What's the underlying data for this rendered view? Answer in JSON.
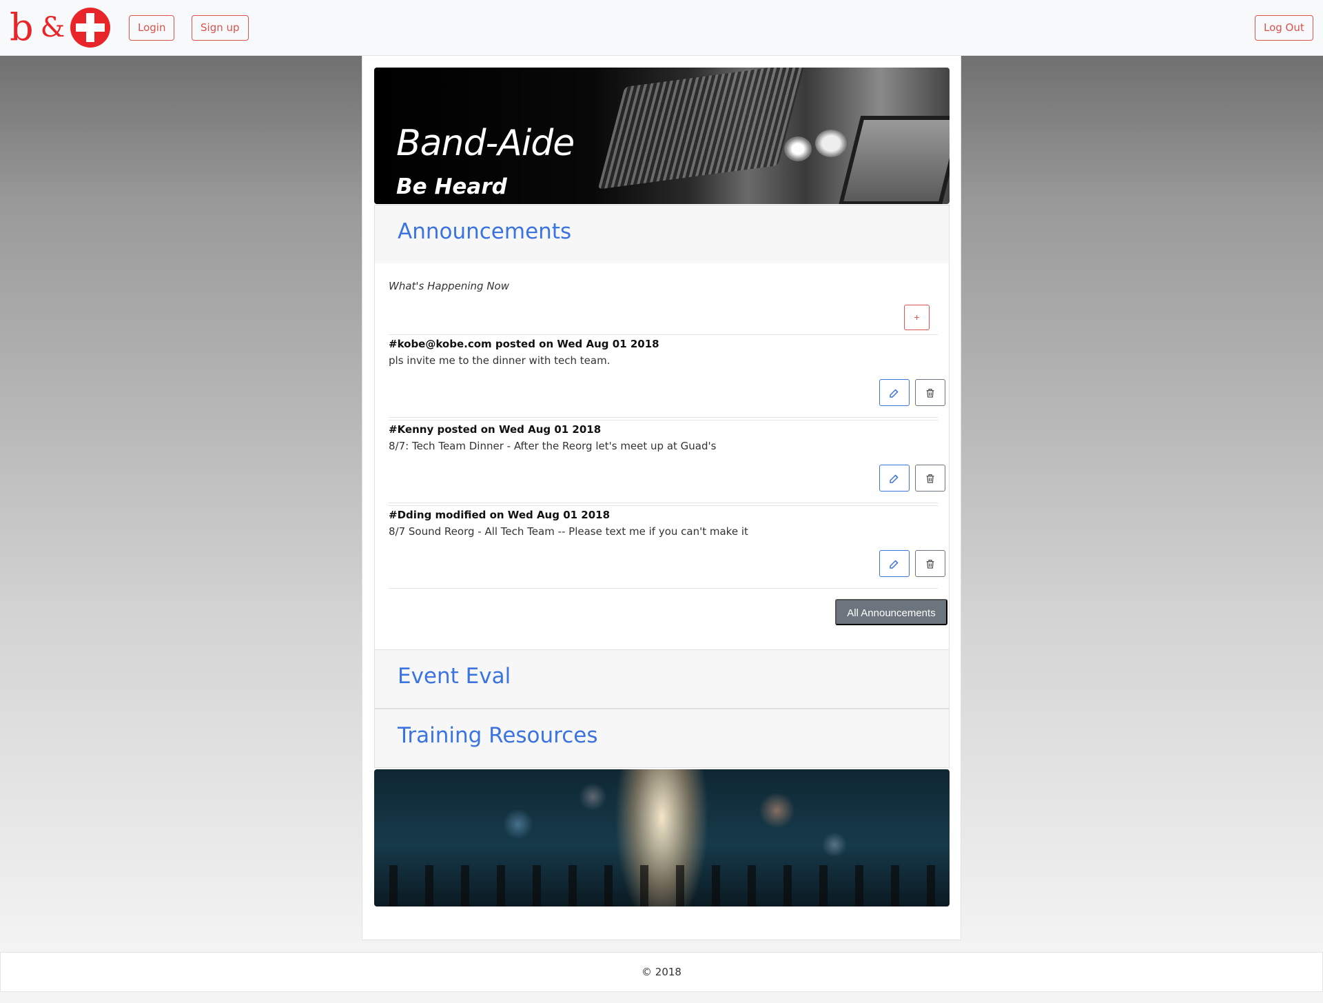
{
  "navbar": {
    "logo": {
      "letter": "b",
      "amp": "&"
    },
    "login_label": "Login",
    "signup_label": "Sign up",
    "logout_label": "Log Out"
  },
  "hero": {
    "title": "Band-Aide",
    "subtitle": "Be Heard"
  },
  "announcements": {
    "heading": "Announcements",
    "subheading": "What's Happening Now",
    "add_label": "+",
    "posts": [
      {
        "header": "#kobe@kobe.com posted on Wed Aug 01 2018",
        "text": "pls invite me to the dinner with tech team."
      },
      {
        "header": "#Kenny posted on Wed Aug 01 2018",
        "text": "8/7: Tech Team Dinner - After the Reorg let's meet up at Guad's"
      },
      {
        "header": "#Dding modified on Wed Aug 01 2018",
        "text": "8/7 Sound Reorg - All Tech Team -- Please text me if you can't make it"
      }
    ],
    "all_label": "All Announcements"
  },
  "event_eval": {
    "heading": "Event Eval"
  },
  "training": {
    "heading": "Training Resources"
  },
  "footer": {
    "text": "© 2018"
  },
  "colors": {
    "accent_red": "#e8262a",
    "link_blue": "#3b73e0",
    "secondary_gray": "#6c757d"
  }
}
